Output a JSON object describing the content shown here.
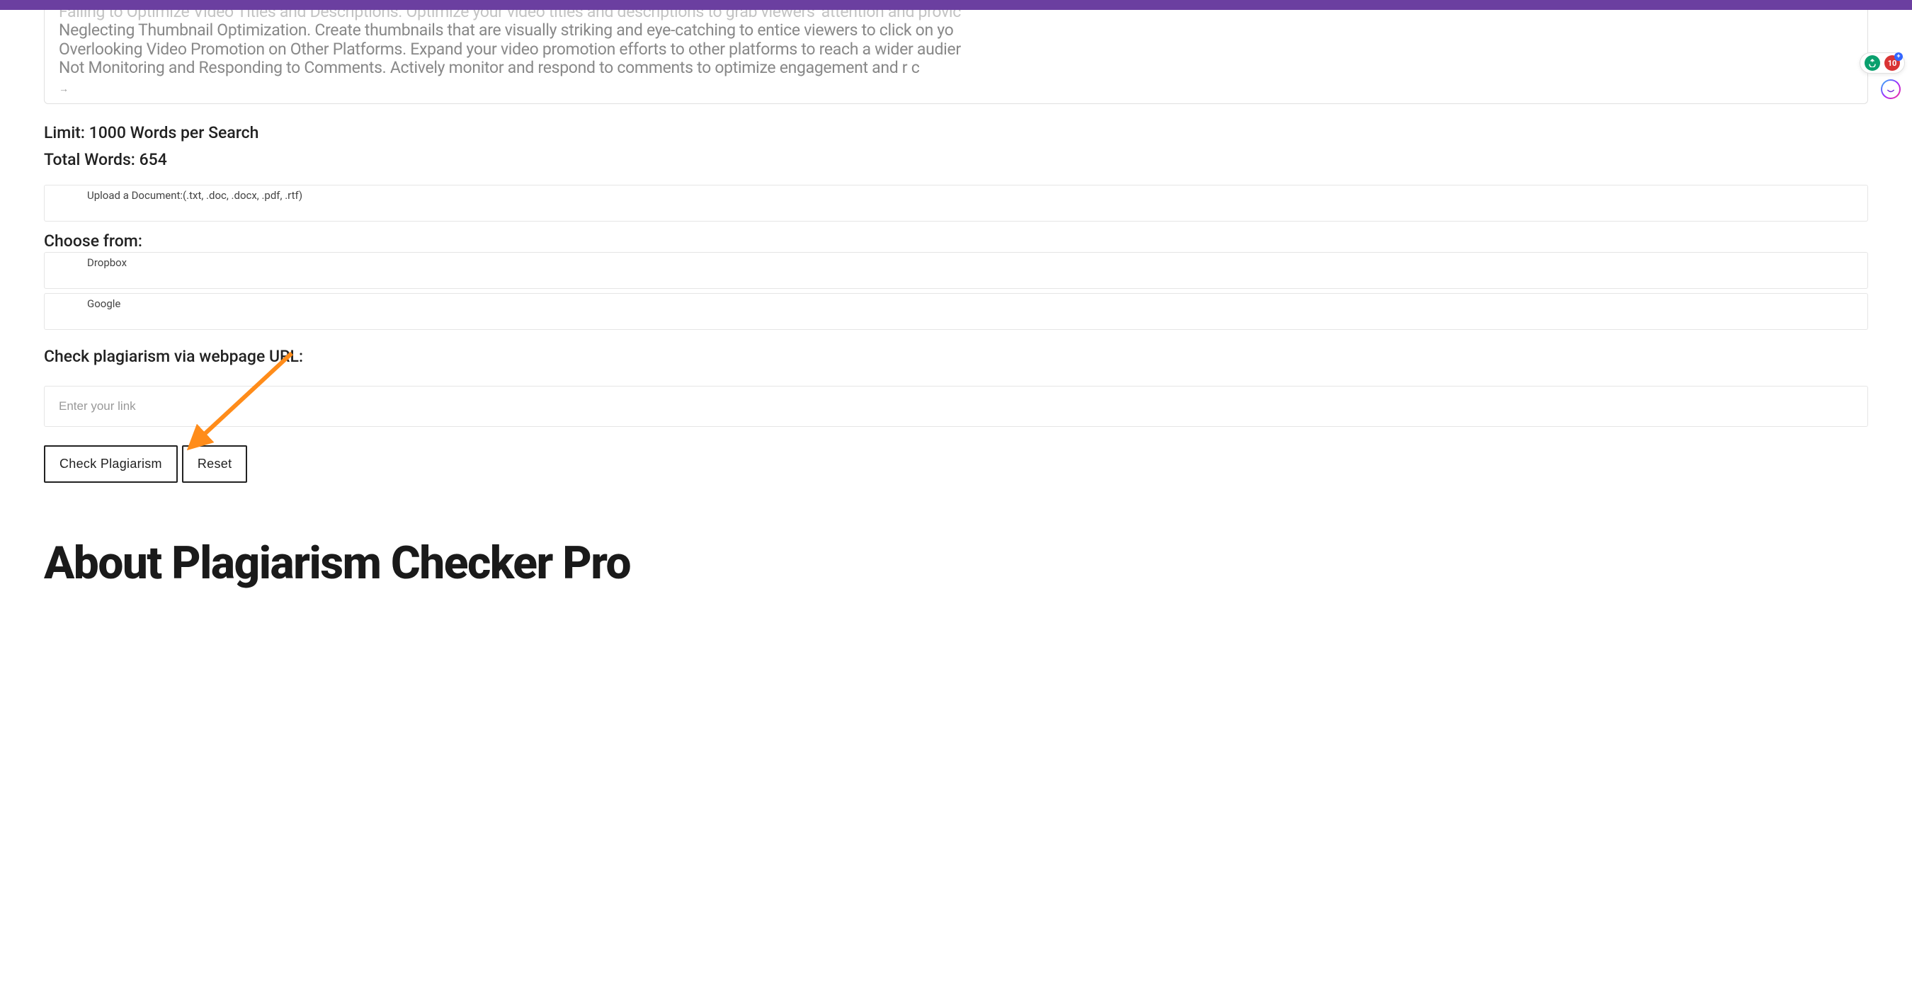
{
  "content_lines": [
    "Failing to Optimize Video Titles and Descriptions. Optimize your video titles and descriptions to grab viewers' attention and provic",
    "Neglecting Thumbnail Optimization. Create thumbnails that are visually striking and eye-catching to entice viewers to click on yo",
    "Overlooking Video Promotion on Other Platforms. Expand your video promotion efforts to other platforms to reach a wider audier",
    "Not Monitoring and Responding to Comments. Actively monitor and respond to comments to optimize engagement and        r c"
  ],
  "limit_label": "Limit: 1000 Words per Search",
  "total_words_label": "Total Words: 654",
  "upload": {
    "label": "Upload a Document:(.txt, .doc, .docx, .pdf, .rtf)"
  },
  "choose_from": {
    "title": "Choose from:",
    "options": [
      "Dropbox",
      "Google"
    ]
  },
  "url_section": {
    "title": "Check plagiarism via webpage URL:",
    "placeholder": "Enter your link"
  },
  "buttons": {
    "check": "Check Plagiarism",
    "reset": "Reset"
  },
  "heading": "About Plagiarism Checker Pro",
  "badges": {
    "green_icon": "↻",
    "red_value": "10"
  }
}
